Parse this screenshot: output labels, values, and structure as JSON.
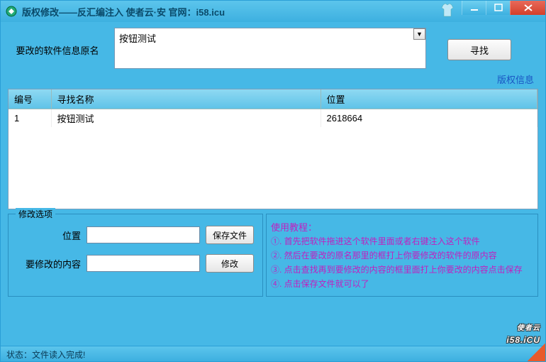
{
  "window": {
    "title": "版权修改——反汇编注入    使者云·安 官网：i58.icu"
  },
  "search": {
    "label": "要改的软件信息原名",
    "value": "按钮测试",
    "find_button": "寻找"
  },
  "copyright_info_link": "版权信息",
  "table": {
    "headers": {
      "col1": "编号",
      "col2": "寻找名称",
      "col3": "位置"
    },
    "rows": [
      {
        "id": "1",
        "name": "按钮测试",
        "pos": "2618664"
      }
    ]
  },
  "options": {
    "legend": "修改选项",
    "pos_label": "位置",
    "pos_value": "",
    "save_file_btn": "保存文件",
    "content_label": "要修改的内容",
    "content_value": "",
    "modify_btn": "修改"
  },
  "tutorial": {
    "title": "使用教程：",
    "steps": [
      "①. 首先把软件拖进这个软件里面或者右键注入这个软件",
      "②. 然后在要改的原名那里的框打上你要修改的软件的原内容",
      "③. 点击查找再到要修改的内容的框里面打上你要改的内容点击保存",
      "④. 点击保存文件就可以了"
    ]
  },
  "status": "状态：文件读入完成!",
  "logo": {
    "small": "使者云",
    "big": "i58.iCU"
  }
}
